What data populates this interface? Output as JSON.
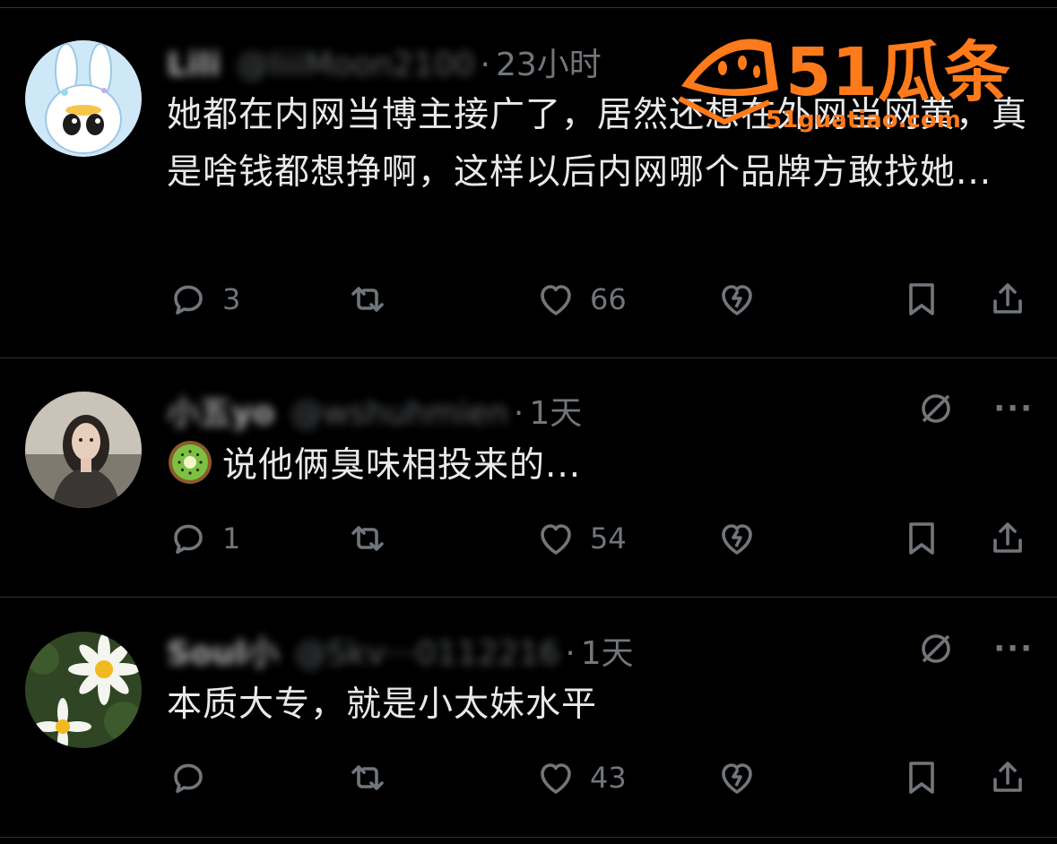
{
  "posts": [
    {
      "name": "Lili",
      "handle": "@liiiMoon2100",
      "time": "23小时",
      "text": "她都在内网当博主接广了，居然还想在外网当网黄，真是啥钱都想挣啊，这样以后内网哪个品牌方敢找她...",
      "reply_count": "3",
      "retweet_count": "",
      "like_count": "66",
      "avatar_icon": "bunny-avatar"
    },
    {
      "name": "小五yo",
      "handle": "@wshuhmien",
      "time": "1天",
      "text": "说他俩臭味相投来的...",
      "reply_count": "1",
      "retweet_count": "",
      "like_count": "54",
      "avatar_icon": "woman-portrait-avatar",
      "emoji": "kiwi-icon"
    },
    {
      "name": "Soul小",
      "handle": "@Skv···0112216",
      "time": "1天",
      "text": "本质大专，就是小太妹水平",
      "reply_count": "",
      "retweet_count": "",
      "like_count": "43",
      "avatar_icon": "daisy-avatar"
    }
  ],
  "watermark": {
    "title": "51瓜条",
    "url": "51guatiao.com",
    "color": "#ff7a1a"
  }
}
